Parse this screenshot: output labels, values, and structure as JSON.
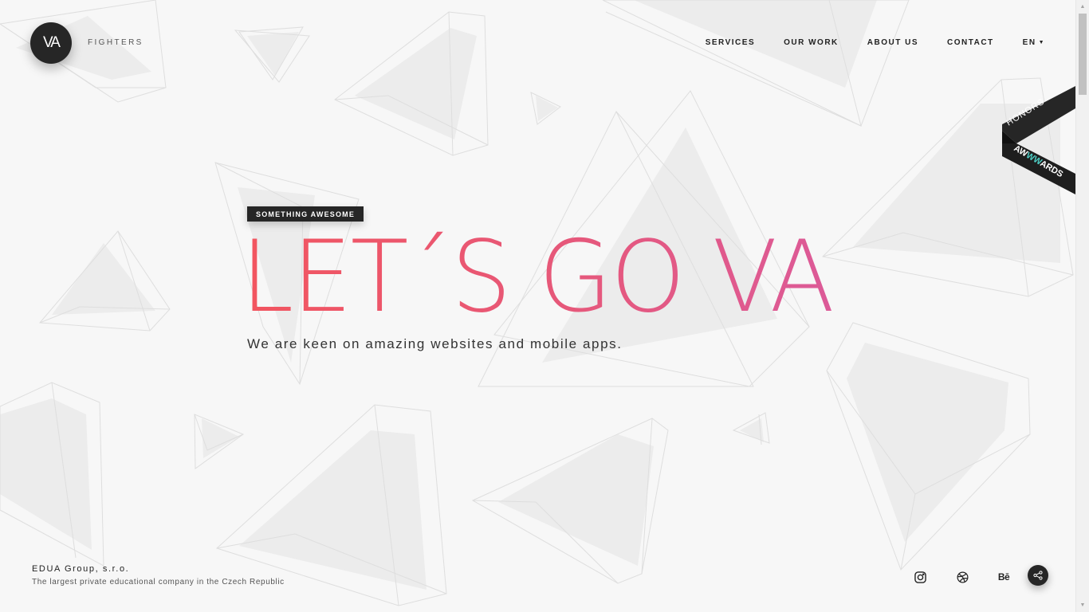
{
  "brand": {
    "logo_text": "VA",
    "tagline": "FIGHTERS"
  },
  "nav": {
    "items": [
      {
        "label": "SERVICES"
      },
      {
        "label": "OUR WORK"
      },
      {
        "label": "ABOUT US"
      },
      {
        "label": "CONTACT"
      }
    ],
    "language": "EN"
  },
  "ribbon": {
    "line1": "HONORS",
    "line2_prefix": "AW",
    "line2_accent": "WW",
    "line2_suffix": "ARDS",
    "accent_color": "#4ecdc4"
  },
  "hero": {
    "badge": "SOMETHING AWESOME",
    "title": "LET´S GO VA",
    "subtitle": "We are keen on amazing websites and mobile apps.",
    "gradient": [
      "#f2555f",
      "#dc5a98"
    ]
  },
  "footer": {
    "company": "EDUA Group, s.r.o.",
    "description": "The largest private educational company in the Czech Republic",
    "social": [
      {
        "icon": "instagram-icon"
      },
      {
        "icon": "dribbble-icon"
      },
      {
        "icon": "behance-icon",
        "label": "Bē"
      }
    ],
    "share_icon": "share-icon"
  },
  "colors": {
    "background": "#f7f7f7",
    "dark": "#262626",
    "triangle_fill": "#ececec",
    "triangle_stroke": "#e0e0e0"
  }
}
